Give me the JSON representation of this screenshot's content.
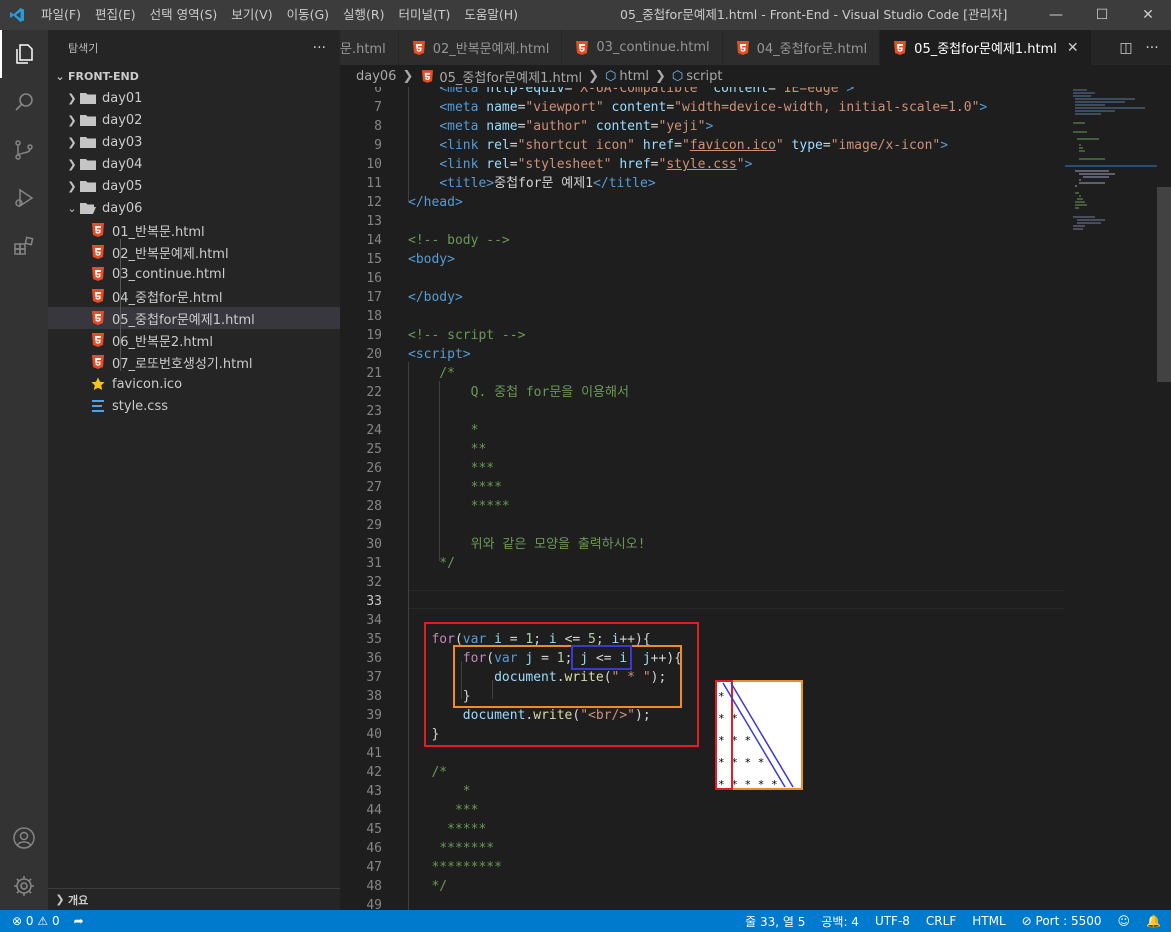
{
  "titlebar": {
    "menu": [
      "파일(F)",
      "편집(E)",
      "선택 영역(S)",
      "보기(V)",
      "이동(G)",
      "실행(R)",
      "터미널(T)",
      "도움말(H)"
    ],
    "title": "05_중첩for문예제1.html - Front-End - Visual Studio Code [관리자]"
  },
  "sidebar": {
    "header": "탐색기",
    "more": "···",
    "root": "FRONT-END",
    "folders": [
      "day01",
      "day02",
      "day03",
      "day04",
      "day05"
    ],
    "open_folder": "day06",
    "files": [
      "01_반복문.html",
      "02_반복문예제.html",
      "03_continue.html",
      "04_중첩for문.html",
      "05_중첩for문예제1.html",
      "06_반복문2.html",
      "07_로또번호생성기.html"
    ],
    "root_files": [
      "favicon.ico",
      "style.css"
    ],
    "outline": "개요"
  },
  "tabs": {
    "items": [
      "문.html",
      "02_반복문예제.html",
      "03_continue.html",
      "04_중첩for문.html",
      "05_중첩for문예제1.html"
    ],
    "active_index": 4
  },
  "breadcrumb": [
    "day06",
    "05_중첩for문예제1.html",
    "html",
    "script"
  ],
  "code": {
    "line_numbers": [
      "6",
      "7",
      "8",
      "9",
      "10",
      "11",
      "12",
      "13",
      "14",
      "15",
      "16",
      "17",
      "18",
      "19",
      "20",
      "21",
      "22",
      "23",
      "24",
      "25",
      "26",
      "27",
      "28",
      "29",
      "30",
      "31",
      "32",
      "33",
      "34",
      "35",
      "36",
      "37",
      "38",
      "39",
      "40",
      "41",
      "42",
      "43",
      "44",
      "45",
      "46",
      "47",
      "48",
      "49"
    ],
    "current_line": "33",
    "comment_lines": {
      "q": "Q. 중첩 for문을 이용해서",
      "s1": "*",
      "s2": "**",
      "s3": "***",
      "s4": "****",
      "s5": "*****",
      "inst": "위와 같은 모양을 출력하시오!",
      "t1": "*",
      "t2": "***",
      "t3": "*****",
      "t4": "*******",
      "t5": "*********"
    },
    "title_text": "중첩for문 예제1"
  },
  "inset_output": [
    "*",
    "* *",
    "* * *",
    "* * * *",
    "* * * * *"
  ],
  "statusbar": {
    "errors": "0",
    "warnings": "0",
    "position": "줄 33, 열 5",
    "spaces": "공백: 4",
    "encoding": "UTF-8",
    "eol": "CRLF",
    "language": "HTML",
    "port": "Port : 5500"
  },
  "colors": {
    "accent": "#007acc",
    "red_box": "#e51c23",
    "orange_box": "#f08c28",
    "blue_box": "#3a3ad0"
  }
}
